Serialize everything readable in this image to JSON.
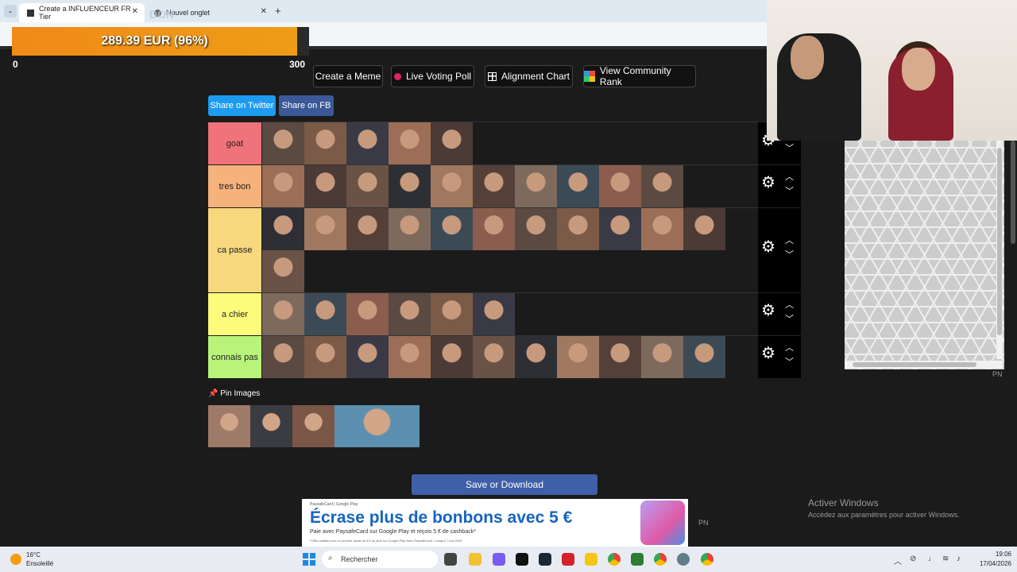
{
  "browser": {
    "tabs": [
      {
        "title": "Create a INFLUENCEUR FR Tier"
      },
      {
        "title": "Nouvel onglet"
      }
    ],
    "new_tab_symbol": "+",
    "close_symbol": "✕"
  },
  "donation": {
    "label": "DON",
    "amount_text": "289.39 EUR (96%)",
    "progress_percent": 96,
    "min_label": "0",
    "max_label": "300"
  },
  "toolbar": {
    "create_meme": "Create a Meme",
    "live_voting_poll": "Live Voting Poll",
    "alignment_chart": "Alignment Chart",
    "view_community_rank": "View Community Rank"
  },
  "share": {
    "twitter": "Share on Twitter",
    "facebook": "Share on FB"
  },
  "tiers": [
    {
      "label": "goat",
      "color": "#f0727a",
      "count": 5
    },
    {
      "label": "tres bon",
      "color": "#f5b27a",
      "count": 10
    },
    {
      "label": "ca passe",
      "color": "#f7d87e",
      "count": 12
    },
    {
      "label": "a chier",
      "color": "#fdfb7c",
      "count": 6
    },
    {
      "label": "connais pas",
      "color": "#b8f47a",
      "count": 11
    }
  ],
  "tier_controls": {
    "gear": "⚙",
    "up": "︿",
    "down": "﹀"
  },
  "pin": {
    "label": "Pin Images",
    "icon": "📌"
  },
  "save_button": "Save or Download",
  "ad": {
    "brand": "PaysafeCard | Google Play",
    "title": "Écrase plus de bonbons avec 5 €",
    "subtitle": "Paie avec PaysafeCard sur Google Play et reçois 5 € de cashback*",
    "fine_print": "*Offre valable pour un premier achat de 5 € ou plus sur Google Play avec PaysafeCard. Lorsque 7 mai 2026"
  },
  "activate_windows": {
    "title": "Activer Windows",
    "subtitle": "Accédez aux paramètres pour activer Windows."
  },
  "pn_label": "PN",
  "taskbar": {
    "weather_temp": "16°C",
    "weather_cond": "Ensoleillé",
    "search_placeholder": "Rechercher",
    "time": "19:06",
    "date": "17/04/2026"
  },
  "colors": {
    "twitter": "#1d9bf0",
    "facebook": "#3b5998",
    "donation_bar": "#f08a18",
    "save_button": "#3f5fa8"
  }
}
